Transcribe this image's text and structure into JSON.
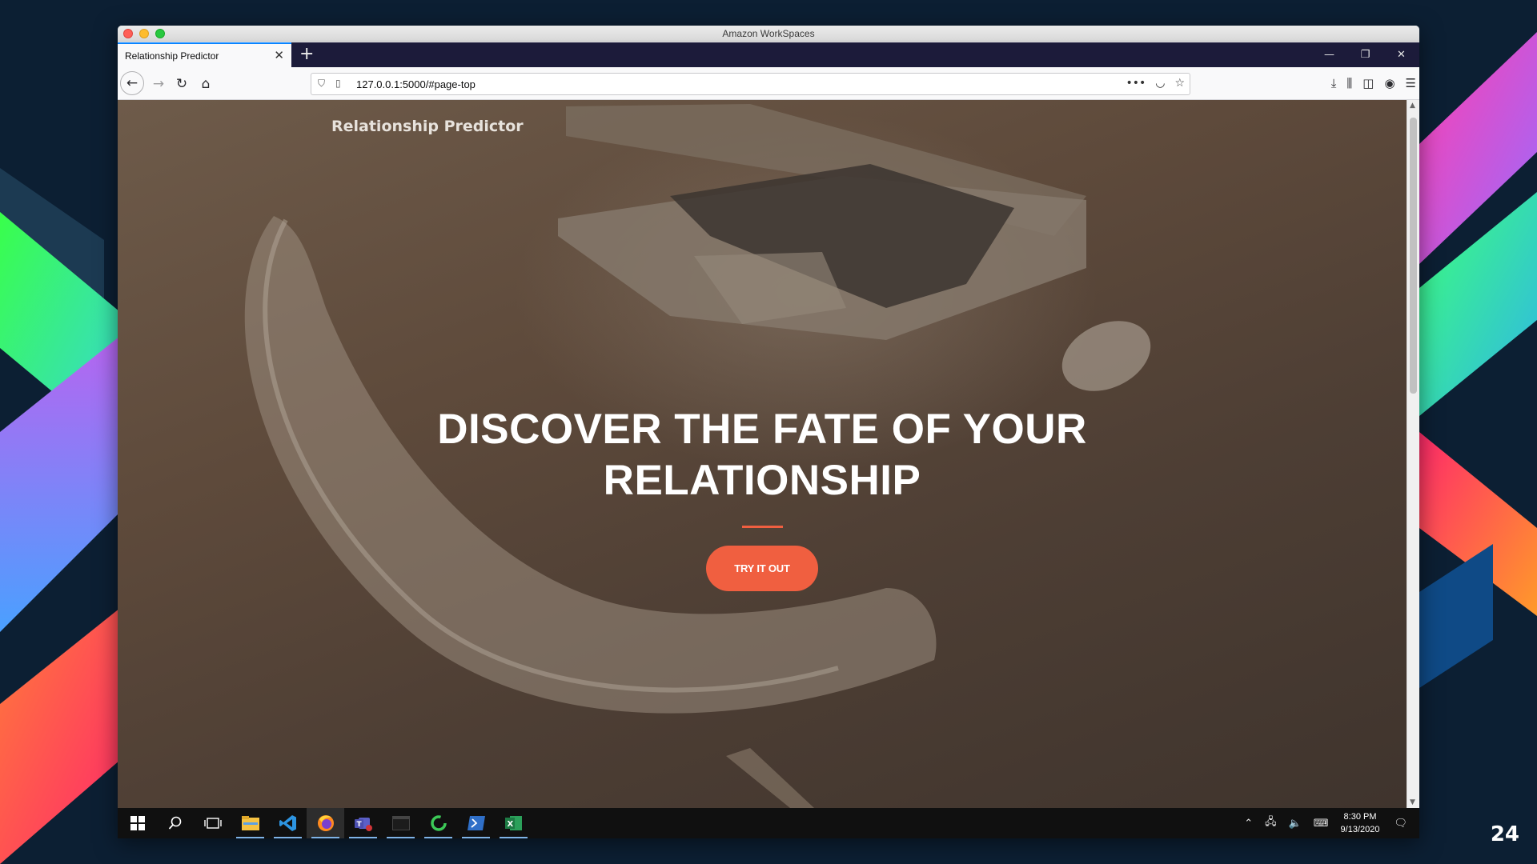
{
  "window": {
    "title": "Amazon WorkSpaces"
  },
  "browser": {
    "tab_title": "Relationship Predictor",
    "tab_close": "✕",
    "new_tab": "+",
    "url": "127.0.0.1:5000/#page-top",
    "controls": {
      "minimize": "—",
      "restore": "❐",
      "close": "✕"
    }
  },
  "page": {
    "brand": "Relationship Predictor",
    "headline_line1": "DISCOVER THE FATE OF YOUR",
    "headline_line2": "RELATIONSHIP",
    "cta_label": "TRY IT OUT",
    "accent_color": "#f05f40"
  },
  "taskbar": {
    "apps": [
      "windows-start",
      "search",
      "task-view",
      "file-explorer",
      "vscode",
      "firefox",
      "teams",
      "terminal",
      "cycle-app",
      "powershell",
      "excel"
    ],
    "time": "8:30 PM",
    "date": "9/13/2020"
  },
  "slide": {
    "number": "24"
  }
}
